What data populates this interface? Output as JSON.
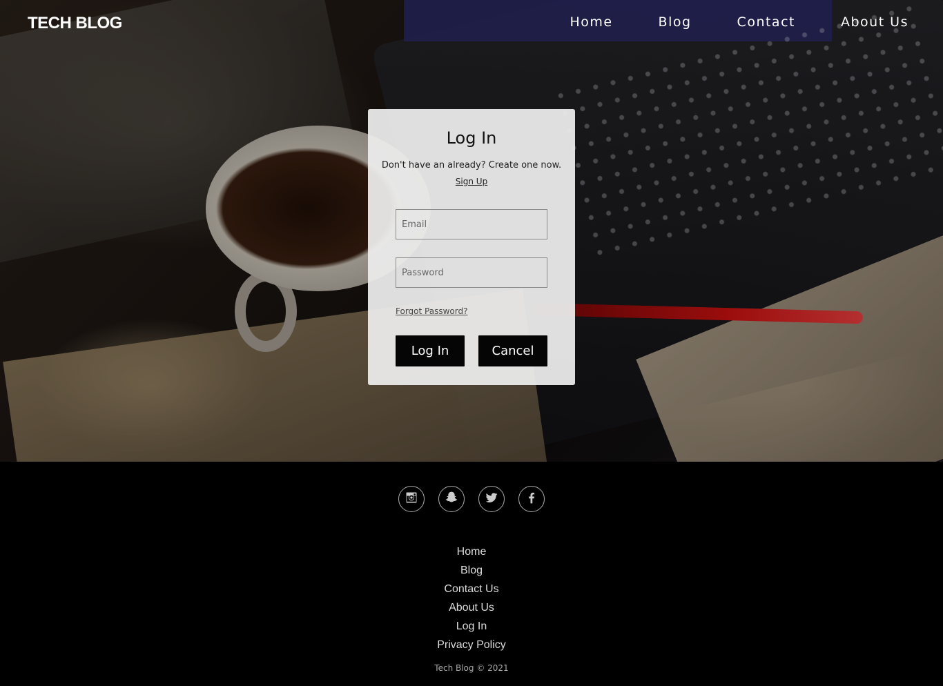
{
  "header": {
    "logo": "TECH BLOG",
    "nav": [
      "Home",
      "Blog",
      "Contact",
      "About Us"
    ]
  },
  "login": {
    "title": "Log In",
    "subtitle": "Don't have an already? Create one now.",
    "signup_link": "Sign Up",
    "email_placeholder": "Email",
    "password_placeholder": "Password",
    "forgot_link": "Forgot Password?",
    "login_button": "Log In",
    "cancel_button": "Cancel"
  },
  "footer": {
    "social": [
      "instagram-icon",
      "snapchat-icon",
      "twitter-icon",
      "facebook-icon"
    ],
    "links": [
      "Home",
      "Blog",
      "Contact Us",
      "About Us",
      "Log In",
      "Privacy Policy"
    ],
    "copyright": "Tech Blog © 2021"
  }
}
